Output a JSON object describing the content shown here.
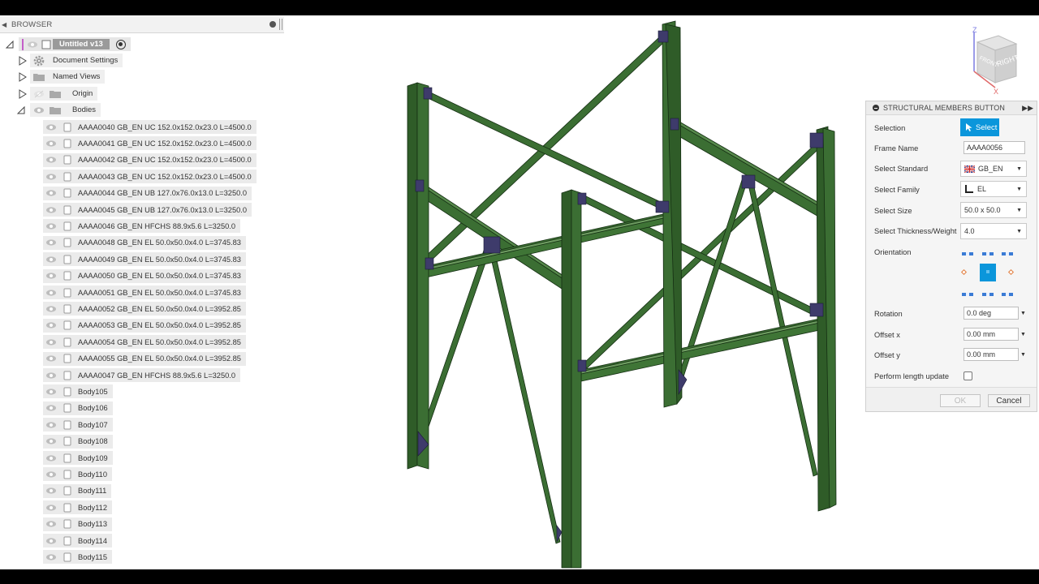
{
  "browser": {
    "title": "BROWSER",
    "root": {
      "name": "Untitled v13"
    },
    "folders": [
      {
        "label": "Document Settings",
        "icon": "gear-icon",
        "expanded": false
      },
      {
        "label": "Named Views",
        "icon": "folder-icon",
        "expanded": false
      },
      {
        "label": "Origin",
        "icon": "folder-icon",
        "expanded": false,
        "visible": false
      },
      {
        "label": "Bodies",
        "icon": "folder-icon",
        "expanded": true
      }
    ],
    "bodies": [
      "AAAA0040 GB_EN UC 152.0x152.0x23.0 L=4500.0",
      "AAAA0041 GB_EN UC 152.0x152.0x23.0 L=4500.0",
      "AAAA0042 GB_EN UC 152.0x152.0x23.0 L=4500.0",
      "AAAA0043 GB_EN UC 152.0x152.0x23.0 L=4500.0",
      "AAAA0044 GB_EN UB 127.0x76.0x13.0 L=3250.0",
      "AAAA0045 GB_EN UB 127.0x76.0x13.0 L=3250.0",
      "AAAA0046 GB_EN HFCHS 88.9x5.6 L=3250.0",
      "AAAA0048 GB_EN EL 50.0x50.0x4.0 L=3745.83",
      "AAAA0049 GB_EN EL 50.0x50.0x4.0 L=3745.83",
      "AAAA0050 GB_EN EL 50.0x50.0x4.0 L=3745.83",
      "AAAA0051 GB_EN EL 50.0x50.0x4.0 L=3745.83",
      "AAAA0052 GB_EN EL 50.0x50.0x4.0 L=3952.85",
      "AAAA0053 GB_EN EL 50.0x50.0x4.0 L=3952.85",
      "AAAA0054 GB_EN EL 50.0x50.0x4.0 L=3952.85",
      "AAAA0055 GB_EN EL 50.0x50.0x4.0 L=3952.85",
      "AAAA0047 GB_EN HFCHS 88.9x5.6 L=3250.0",
      "Body105",
      "Body106",
      "Body107",
      "Body108",
      "Body109",
      "Body110",
      "Body111",
      "Body112",
      "Body113",
      "Body114",
      "Body115"
    ]
  },
  "viewcube": {
    "face_label": "RIGHT",
    "side_label": "FRONT",
    "axis_z": "Z",
    "axis_x": "X"
  },
  "dialog": {
    "title": "STRUCTURAL MEMBERS BUTTON",
    "selection_label": "Selection",
    "select_button": "Select",
    "frame_name_label": "Frame Name",
    "frame_name_value": "AAAA0056",
    "standard_label": "Select Standard",
    "standard_value": "GB_EN",
    "family_label": "Select Family",
    "family_value": "EL",
    "size_label": "Select Size",
    "size_value": "50.0 x 50.0",
    "thickness_label": "Select Thickness/Weight",
    "thickness_value": "4.0",
    "orientation_label": "Orientation",
    "rotation_label": "Rotation",
    "rotation_value": "0.0 deg",
    "offset_x_label": "Offset x",
    "offset_x_value": "0.00 mm",
    "offset_y_label": "Offset y",
    "offset_y_value": "0.00 mm",
    "length_update_label": "Perform length update",
    "length_update_checked": false,
    "ok_label": "OK",
    "cancel_label": "Cancel"
  },
  "colors": {
    "steel": "#3b6e33",
    "steel_dark": "#1f3f1b",
    "plate": "#3e3b6b",
    "accent": "#0b96db"
  }
}
